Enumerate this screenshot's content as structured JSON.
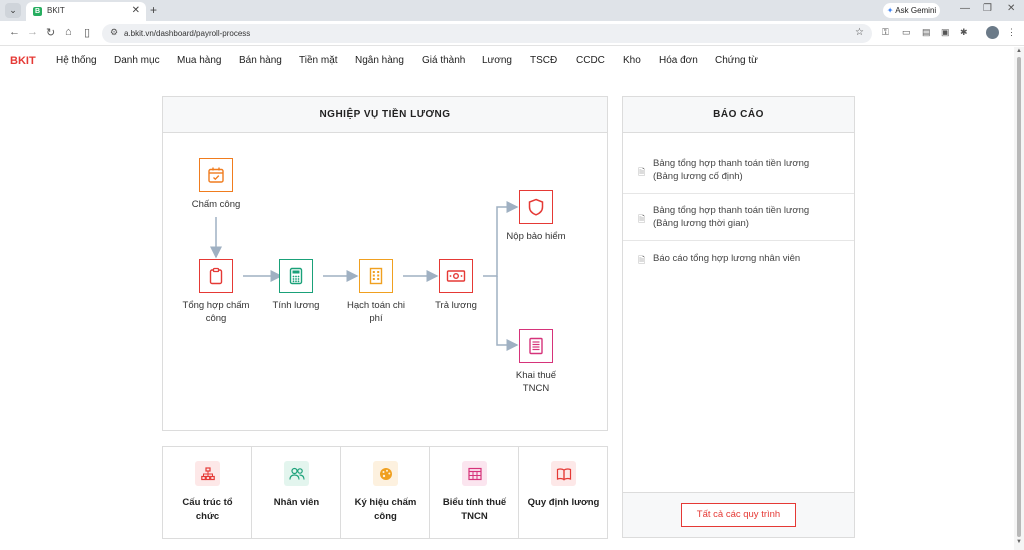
{
  "browser": {
    "tab_title": "BKIT",
    "tab_favicon": "B",
    "url": "a.bkit.vn/dashboard/payroll-process",
    "gemini_label": "Ask Gemini"
  },
  "app": {
    "logo": "BKIT",
    "brand_color": "#e53935",
    "menu": [
      "Hệ thống",
      "Danh mục",
      "Mua hàng",
      "Bán hàng",
      "Tiền mặt",
      "Ngân hàng",
      "Giá thành",
      "Lương",
      "TSCĐ",
      "CCDC",
      "Kho",
      "Hóa đơn",
      "Chứng từ"
    ]
  },
  "process": {
    "title": "NGHIỆP VỤ TIỀN LƯƠNG",
    "nodes": [
      {
        "label": "Chấm công",
        "icon": "calendar-check-icon",
        "color": "#f07c1e"
      },
      {
        "label": "Tổng hợp chấm công",
        "icon": "clipboard-icon",
        "color": "#e53935"
      },
      {
        "label": "Tính lương",
        "icon": "calculator-icon",
        "color": "#1aa179"
      },
      {
        "label": "Hạch toán chi phí",
        "icon": "building-icon",
        "color": "#f0a020"
      },
      {
        "label": "Trả lương",
        "icon": "cash-icon",
        "color": "#e53935"
      },
      {
        "label": "Nộp bảo hiểm",
        "icon": "shield-icon",
        "color": "#e53935"
      },
      {
        "label": "Khai thuế TNCN",
        "icon": "document-list-icon",
        "color": "#d6337a"
      }
    ]
  },
  "reports": {
    "title": "BÁO CÁO",
    "items": [
      {
        "line1": "Bảng tổng hợp thanh toán tiền lương",
        "line2": "(Bảng lương cố định)"
      },
      {
        "line1": "Bảng tổng hợp thanh toán tiền lương",
        "line2": "(Bảng lương thời gian)"
      },
      {
        "line1": "Báo cáo tổng hợp lương nhân viên",
        "line2": ""
      }
    ],
    "all_button": "Tất cả các quy trình"
  },
  "tiles": [
    {
      "line1": "Cấu trúc tổ",
      "line2": "chức",
      "icon": "org-chart-icon",
      "color": "#e53935",
      "bg": "#fde8e8"
    },
    {
      "line1": "Nhân viên",
      "line2": "",
      "icon": "users-icon",
      "color": "#1aa179",
      "bg": "#e3f5ee"
    },
    {
      "line1": "Ký hiệu chấm",
      "line2": "công",
      "icon": "palette-icon",
      "color": "#f0a020",
      "bg": "#fdf1df"
    },
    {
      "line1": "Biểu tính thuế",
      "line2": "TNCN",
      "icon": "table-icon",
      "color": "#d6337a",
      "bg": "#fbe5ef"
    },
    {
      "line1": "Quy định lương",
      "line2": "",
      "icon": "book-icon",
      "color": "#e53935",
      "bg": "#fde8e8"
    }
  ]
}
